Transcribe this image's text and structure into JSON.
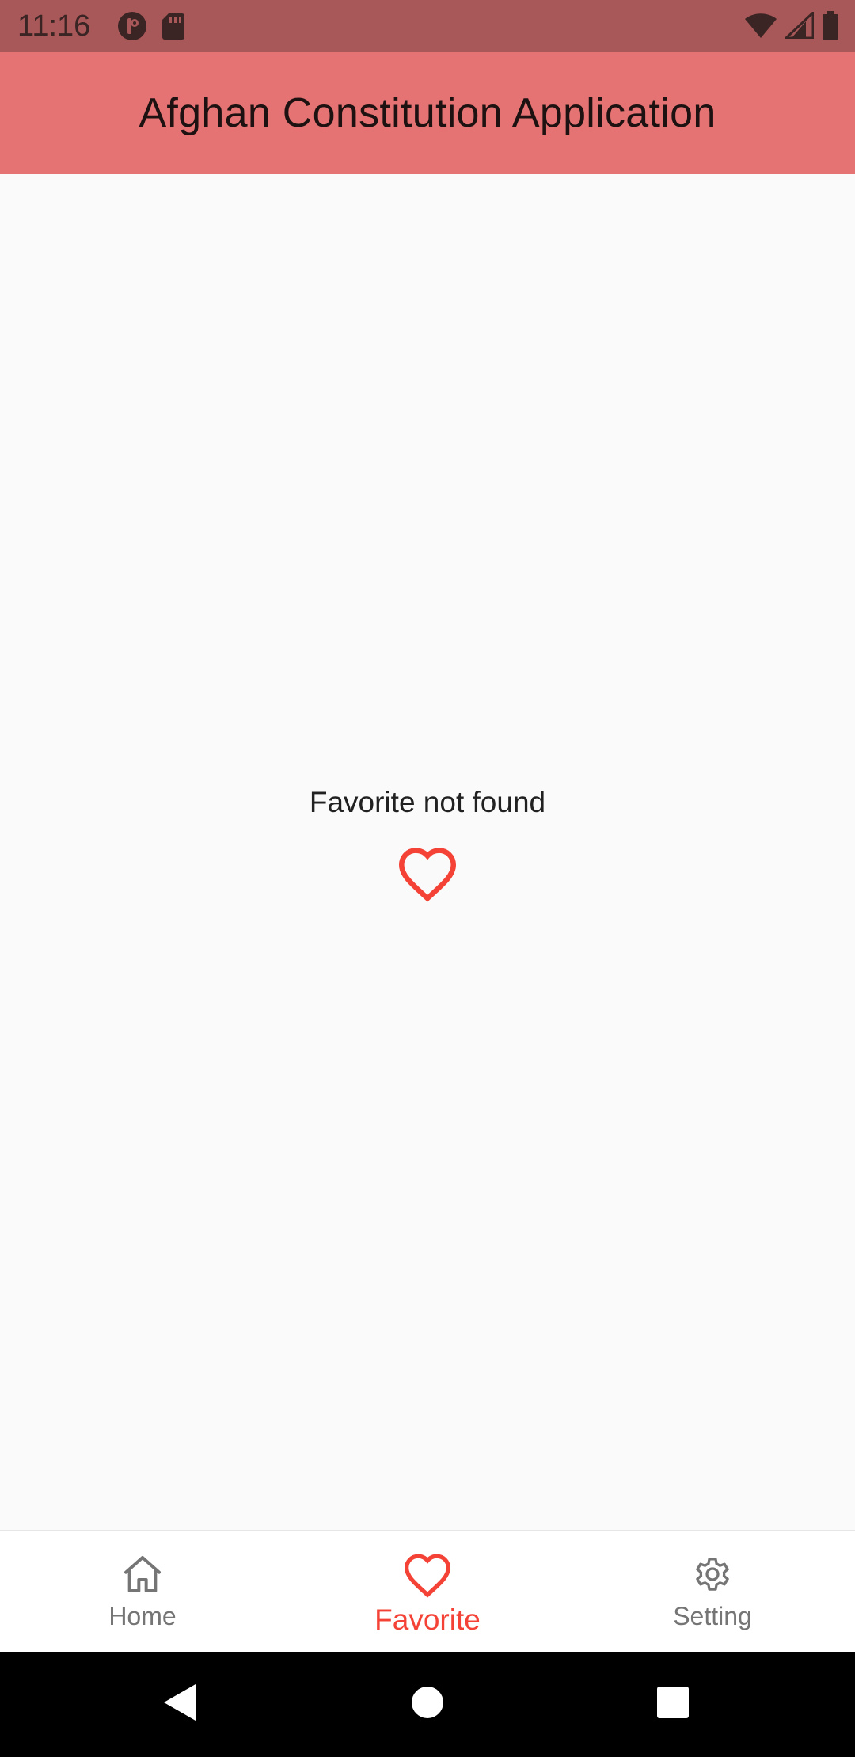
{
  "status_bar": {
    "time": "11:16",
    "left_icons": [
      "podcast-app-icon",
      "sd-card-icon"
    ],
    "right_icons": [
      "wifi-icon",
      "cellular-signal-icon",
      "battery-icon"
    ]
  },
  "app_bar": {
    "title": "Afghan Constitution Application",
    "color": "#e57373"
  },
  "empty_state": {
    "message": "Favorite not found",
    "icon": "heart-outline-icon",
    "icon_color": "#f44336"
  },
  "bottom_nav": {
    "items": [
      {
        "label": "Home",
        "icon": "home-icon",
        "active": false
      },
      {
        "label": "Favorite",
        "icon": "heart-outline-icon",
        "active": true
      },
      {
        "label": "Setting",
        "icon": "gear-icon",
        "active": false
      }
    ],
    "active_color": "#f44336",
    "inactive_color": "#757575"
  },
  "system_nav": {
    "buttons": [
      "back-icon",
      "home-circle-icon",
      "recents-icon"
    ]
  }
}
